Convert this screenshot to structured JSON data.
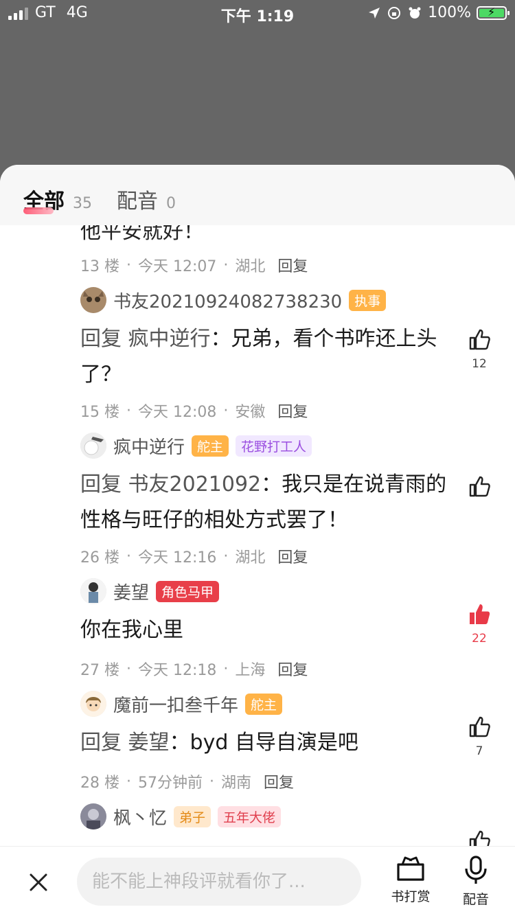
{
  "status_bar": {
    "carrier": "GT",
    "network": "4G",
    "time": "下午 1:19",
    "battery": "100%"
  },
  "tabs": [
    {
      "label": "全部",
      "count": "35"
    },
    {
      "label": "配音",
      "count": "0"
    }
  ],
  "partial_text": "他平安就好！",
  "comments": [
    {
      "floor": "13 楼",
      "time": "今天 12:07",
      "location": "湖北",
      "reply": "回复"
    },
    {
      "user": "书友20210924082738230",
      "badges": [
        "执事"
      ],
      "prefix": "回复 疯中逆行",
      "text": "：兄弟，看个书咋还上头了？",
      "likes": "12",
      "floor": "15 楼",
      "time": "今天 12:08",
      "location": "安徽",
      "reply": "回复"
    },
    {
      "user": "疯中逆行",
      "badges": [
        "舵主",
        "花野打工人"
      ],
      "prefix": "回复 书友2021092",
      "text": "：我只是在说青雨的性格与旺仔的相处方式罢了！",
      "likes": "",
      "floor": "26 楼",
      "time": "今天 12:16",
      "location": "湖北",
      "reply": "回复"
    },
    {
      "user": "姜望",
      "badges": [
        "角色马甲"
      ],
      "prefix": "",
      "text": "你在我心里",
      "likes": "22",
      "floor": "27 楼",
      "time": "今天 12:18",
      "location": "上海",
      "reply": "回复"
    },
    {
      "user": "魔前一扣叁千年",
      "badges": [
        "舵主"
      ],
      "prefix": "回复 姜望",
      "text": "：byd 自导自演是吧",
      "likes": "7",
      "floor": "28 楼",
      "time": "57分钟前",
      "location": "湖南",
      "reply": "回复"
    },
    {
      "user": "枫丶忆",
      "badges": [
        "弟子",
        "五年大佬"
      ]
    }
  ],
  "bottom_bar": {
    "input_placeholder": "能不能上神段评就看你了...",
    "reward_label": "书打赏",
    "dub_label": "配音"
  },
  "colors": {
    "accent": "#e83a48",
    "badge_orange": "#ffb347",
    "badge_red": "#e83f49"
  }
}
